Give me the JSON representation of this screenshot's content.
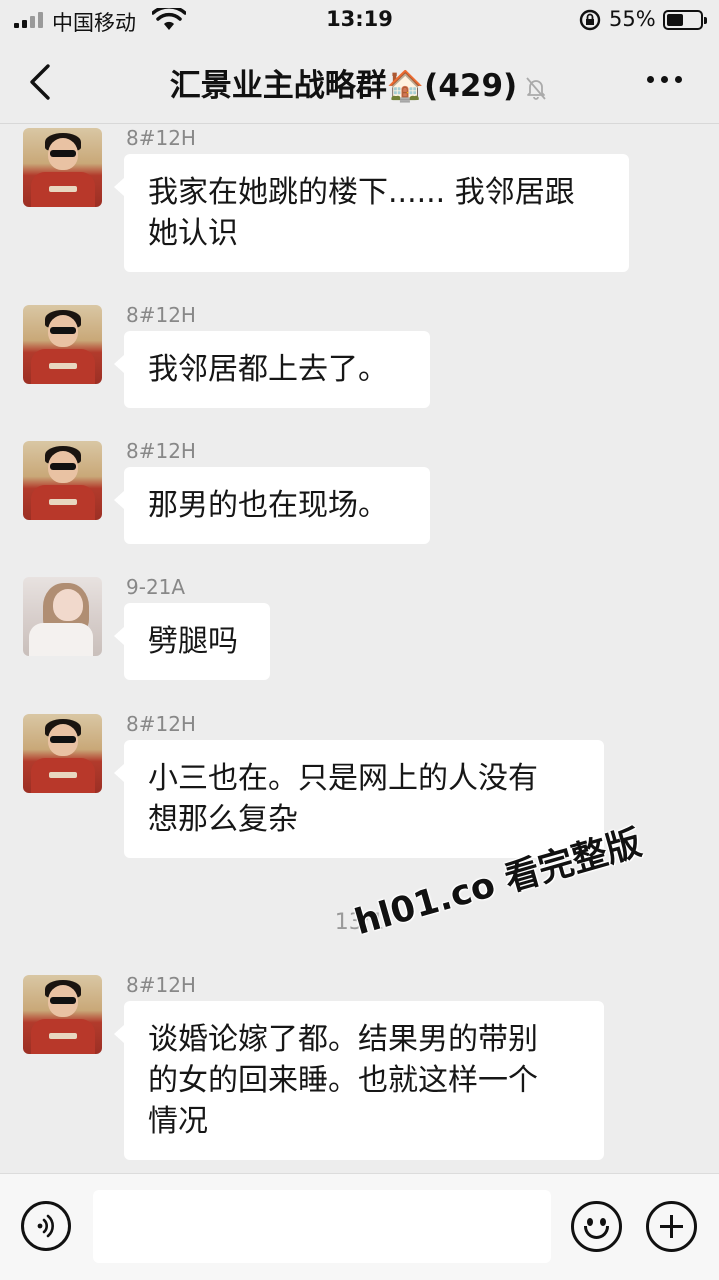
{
  "status_bar": {
    "carrier": "中国移动",
    "time": "13:19",
    "battery": "55%",
    "battery_level": 0.55
  },
  "header": {
    "title": "汇景业主战略群",
    "title_icon": "🏠",
    "member_count": "(429)",
    "muted_icon": "bell-muted-icon"
  },
  "messages": [
    {
      "sender": "8#12H",
      "avatar": "avatar-boy",
      "text": [
        "我家在她跳的楼下...... 我邻居跟",
        "她认识"
      ]
    },
    {
      "sender": "8#12H",
      "avatar": "avatar-boy",
      "text": [
        "我邻居都上去了。"
      ]
    },
    {
      "sender": "8#12H",
      "avatar": "avatar-boy",
      "text": [
        "那男的也在现场。"
      ]
    },
    {
      "sender": "9-21A",
      "avatar": "avatar-girl",
      "text": [
        "劈腿吗"
      ]
    },
    {
      "sender": "8#12H",
      "avatar": "avatar-boy",
      "text": [
        "小三也在。只是网上的人没有",
        "想那么复杂"
      ]
    },
    {
      "sender": "8#12H",
      "avatar": "avatar-boy",
      "text": [
        "谈婚论嫁了都。结果男的带别",
        "的女的回来睡。也就这样一个",
        "情况"
      ]
    }
  ],
  "time_separator": "13:1",
  "watermark": "hl01.co 看完整版",
  "input_bar": {
    "voice_icon": "voice-icon",
    "emoji_icon": "emoji-icon",
    "plus_icon": "plus-icon",
    "input_value": ""
  }
}
